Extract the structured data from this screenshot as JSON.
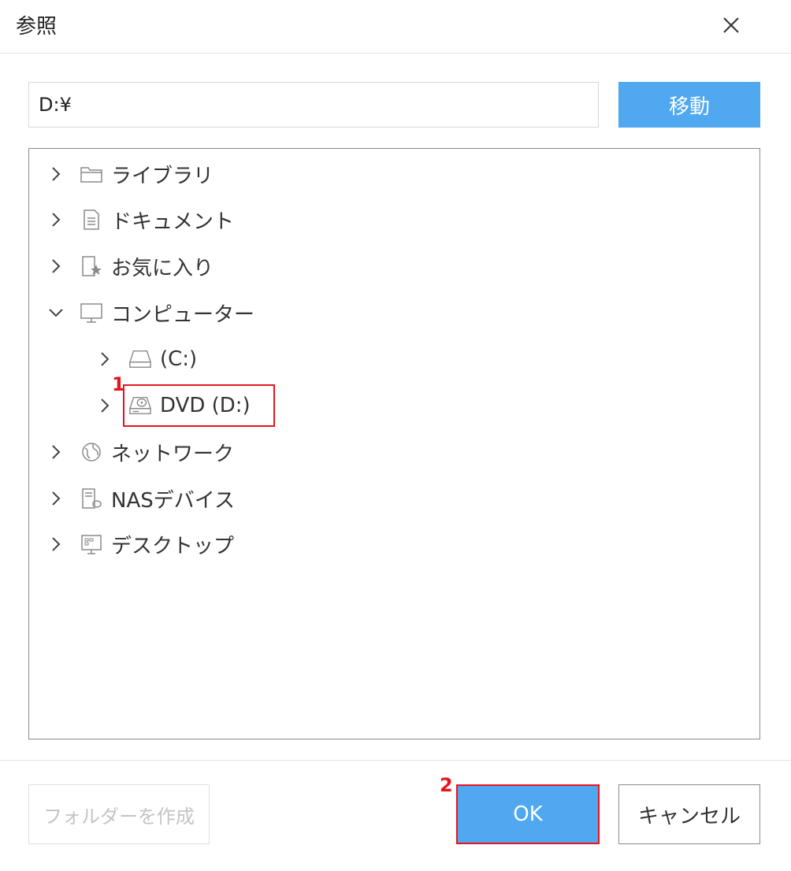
{
  "dialog": {
    "title": "参照",
    "close_icon": "close-icon"
  },
  "path_bar": {
    "value": "D:¥",
    "go_label": "移動"
  },
  "tree": {
    "items": [
      {
        "label": "ライブラリ",
        "icon": "folder-icon",
        "expanded": false,
        "level": 0
      },
      {
        "label": "ドキュメント",
        "icon": "document-icon",
        "expanded": false,
        "level": 0
      },
      {
        "label": "お気に入り",
        "icon": "favorites-icon",
        "expanded": false,
        "level": 0
      },
      {
        "label": "コンピューター",
        "icon": "monitor-icon",
        "expanded": true,
        "level": 0
      },
      {
        "label": "(C:)",
        "icon": "hard-drive-icon",
        "expanded": false,
        "level": 1
      },
      {
        "label": "DVD (D:)",
        "icon": "dvd-drive-icon",
        "expanded": false,
        "level": 1,
        "highlighted": true
      },
      {
        "label": "ネットワーク",
        "icon": "network-globe-icon",
        "expanded": false,
        "level": 0
      },
      {
        "label": "NASデバイス",
        "icon": "nas-device-icon",
        "expanded": false,
        "level": 0
      },
      {
        "label": "デスクトップ",
        "icon": "desktop-icon",
        "expanded": false,
        "level": 0
      }
    ]
  },
  "annotations": {
    "step1": "1",
    "step2": "2",
    "highlight_color": "#e8141c"
  },
  "footer": {
    "new_folder_label": "フォルダーを作成",
    "ok_label": "OK",
    "cancel_label": "キャンセル"
  },
  "colors": {
    "accent": "#4fa8f0",
    "border": "#8a8a8a",
    "disabled_text": "#c4c4c4"
  }
}
